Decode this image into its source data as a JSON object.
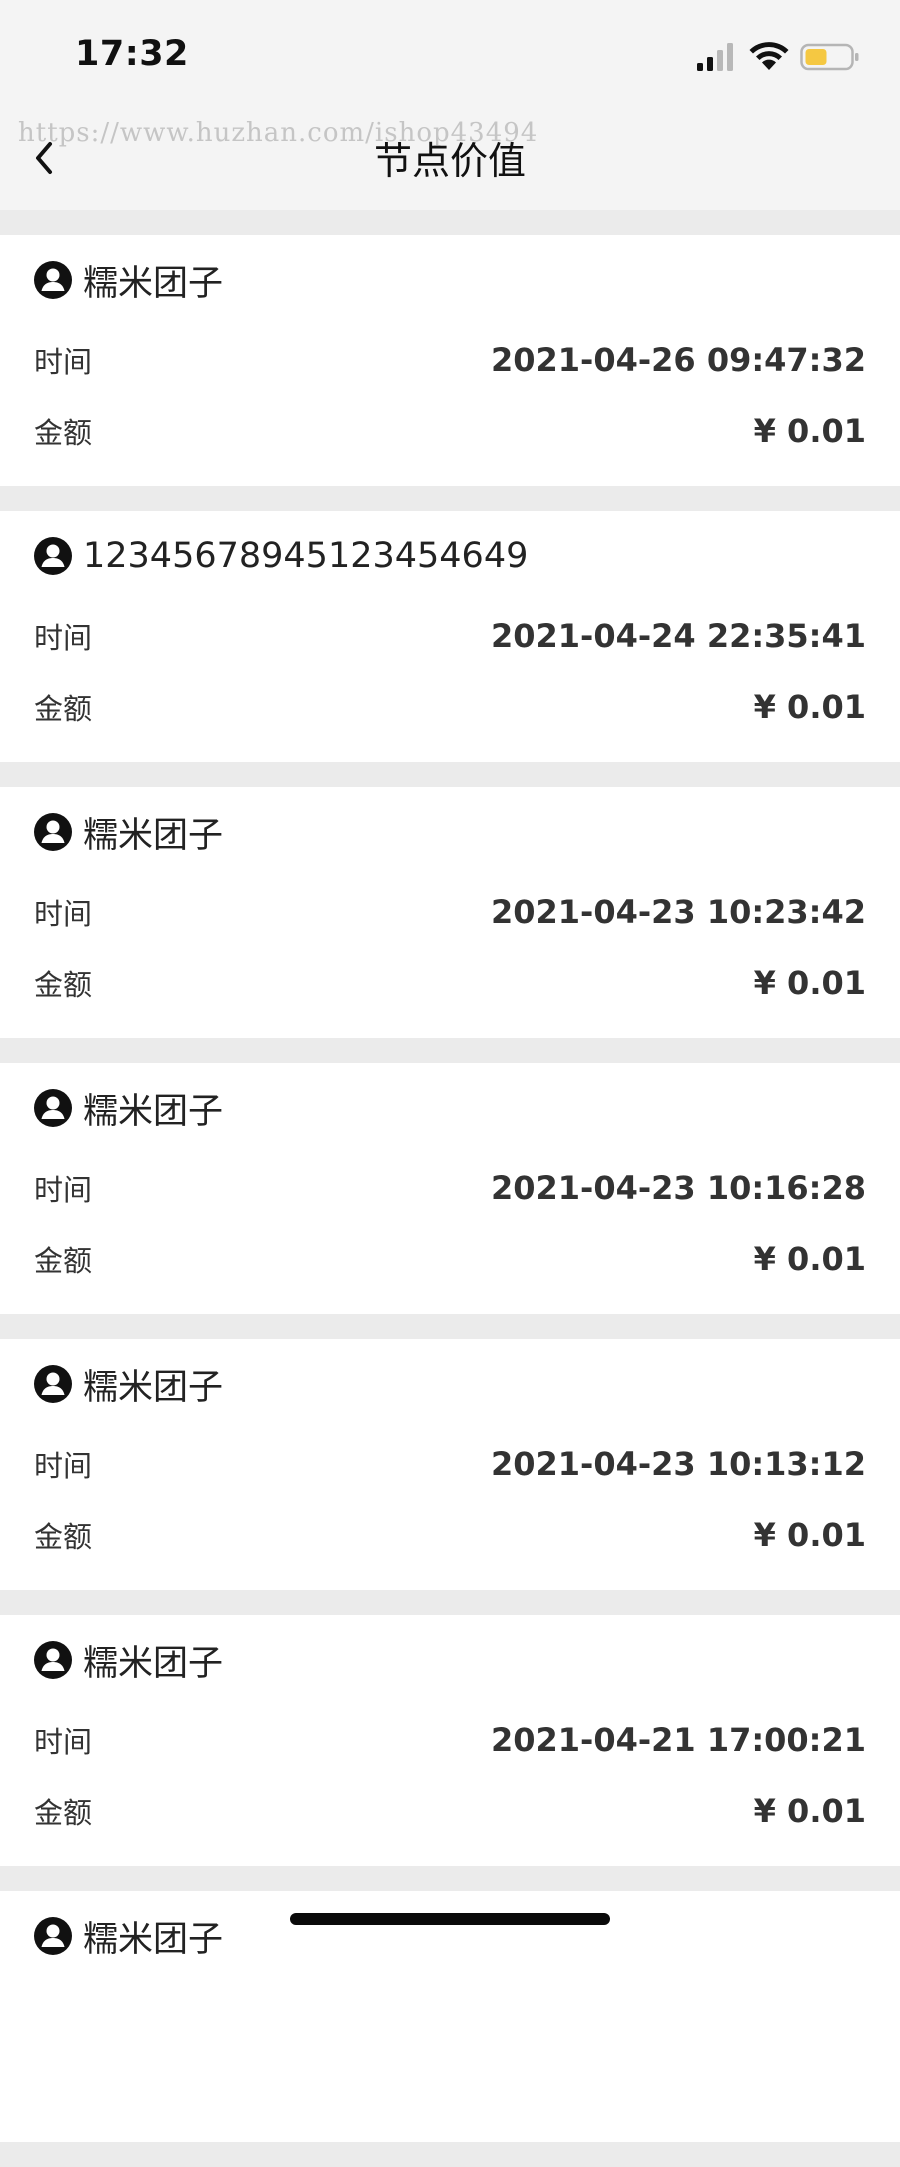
{
  "status_bar": {
    "time": "17:32",
    "battery_color": "#f5c842"
  },
  "watermark": "https://www.huzhan.com/ishop43494",
  "header": {
    "title": "节点价值",
    "back_icon": "chevron-left-icon"
  },
  "records": [
    {
      "name": "糯米团子",
      "time_label": "时间",
      "time": "2021-04-26 09:47:32",
      "amount_label": "金额",
      "amount": "¥ 0.01"
    },
    {
      "name": "12345678945123454649",
      "time_label": "时间",
      "time": "2021-04-24 22:35:41",
      "amount_label": "金额",
      "amount": "¥ 0.01"
    },
    {
      "name": "糯米团子",
      "time_label": "时间",
      "time": "2021-04-23 10:23:42",
      "amount_label": "金额",
      "amount": "¥ 0.01"
    },
    {
      "name": "糯米团子",
      "time_label": "时间",
      "time": "2021-04-23 10:16:28",
      "amount_label": "金额",
      "amount": "¥ 0.01"
    },
    {
      "name": "糯米团子",
      "time_label": "时间",
      "time": "2021-04-23 10:13:12",
      "amount_label": "金额",
      "amount": "¥ 0.01"
    },
    {
      "name": "糯米团子",
      "time_label": "时间",
      "time": "2021-04-21 17:00:21",
      "amount_label": "金额",
      "amount": "¥ 0.01"
    },
    {
      "name": "糯米团子",
      "time_label": "",
      "time": "",
      "amount_label": "",
      "amount": ""
    }
  ]
}
